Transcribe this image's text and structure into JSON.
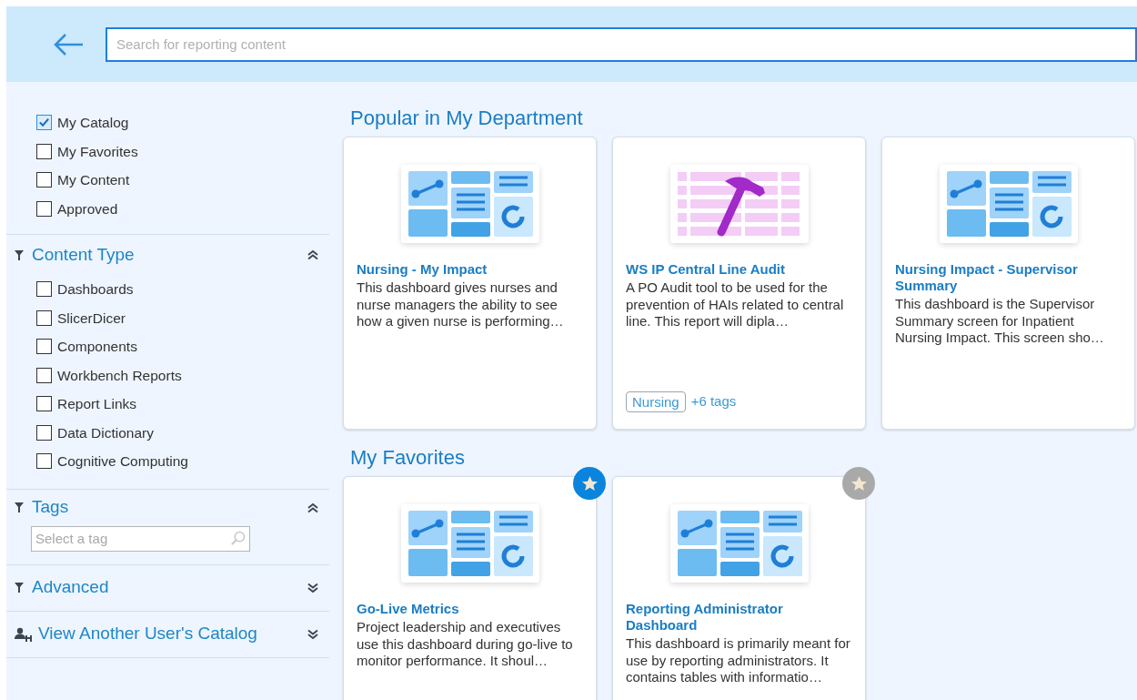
{
  "header": {
    "search": {
      "placeholder": "Search for reporting content"
    }
  },
  "sidebar": {
    "filters": [
      {
        "label": "My Catalog",
        "checked": true
      },
      {
        "label": "My Favorites",
        "checked": false
      },
      {
        "label": "My Content",
        "checked": false
      },
      {
        "label": "Approved",
        "checked": false
      }
    ],
    "sections": [
      {
        "title": "Content Type",
        "kind": "filter",
        "expanded": true,
        "options": [
          {
            "label": "Dashboards",
            "checked": false
          },
          {
            "label": "SlicerDicer",
            "checked": false
          },
          {
            "label": "Components",
            "checked": false
          },
          {
            "label": "Workbench Reports",
            "checked": false
          },
          {
            "label": "Report Links",
            "checked": false
          },
          {
            "label": "Data Dictionary",
            "checked": false
          },
          {
            "label": "Cognitive Computing",
            "checked": false
          }
        ]
      },
      {
        "title": "Tags",
        "kind": "filter",
        "expanded": true,
        "tag_field": {
          "placeholder": "Select a tag"
        }
      },
      {
        "title": "Advanced",
        "kind": "filter",
        "expanded": false
      },
      {
        "title": "View Another User's Catalog",
        "kind": "user",
        "expanded": false
      }
    ]
  },
  "groups": [
    {
      "title": "Popular in My Department",
      "cards": [
        {
          "kind": "dashboard",
          "title": "Nursing - My Impact",
          "description": "This dashboard gives nurses and nurse managers the ability to see how a given nurse is performing…"
        },
        {
          "kind": "report-tool",
          "title": "WS IP Central Line Audit",
          "description": "A PO Audit tool to be used for the prevention of HAIs related to central line. This report will dipla…",
          "tags": [
            "Nursing"
          ],
          "more_tags": "+6 tags"
        },
        {
          "kind": "dashboard",
          "title": "Nursing Impact - Supervisor Summary",
          "description": "This dashboard is the Supervisor Summary screen for Inpatient Nursing Impact. This screen sho…"
        }
      ]
    },
    {
      "title": "My Favorites",
      "cards": [
        {
          "kind": "dashboard",
          "title": "Go-Live Metrics",
          "description": "Project leadership and executives use this dashboard during go-live to monitor performance. It shoul…",
          "favorite": true
        },
        {
          "kind": "dashboard",
          "title": "Reporting Administrator Dashboard",
          "description": "This dashboard is primarily meant for use by reporting administrators. It contains tables with informatio…",
          "favorite": false
        }
      ]
    }
  ]
}
